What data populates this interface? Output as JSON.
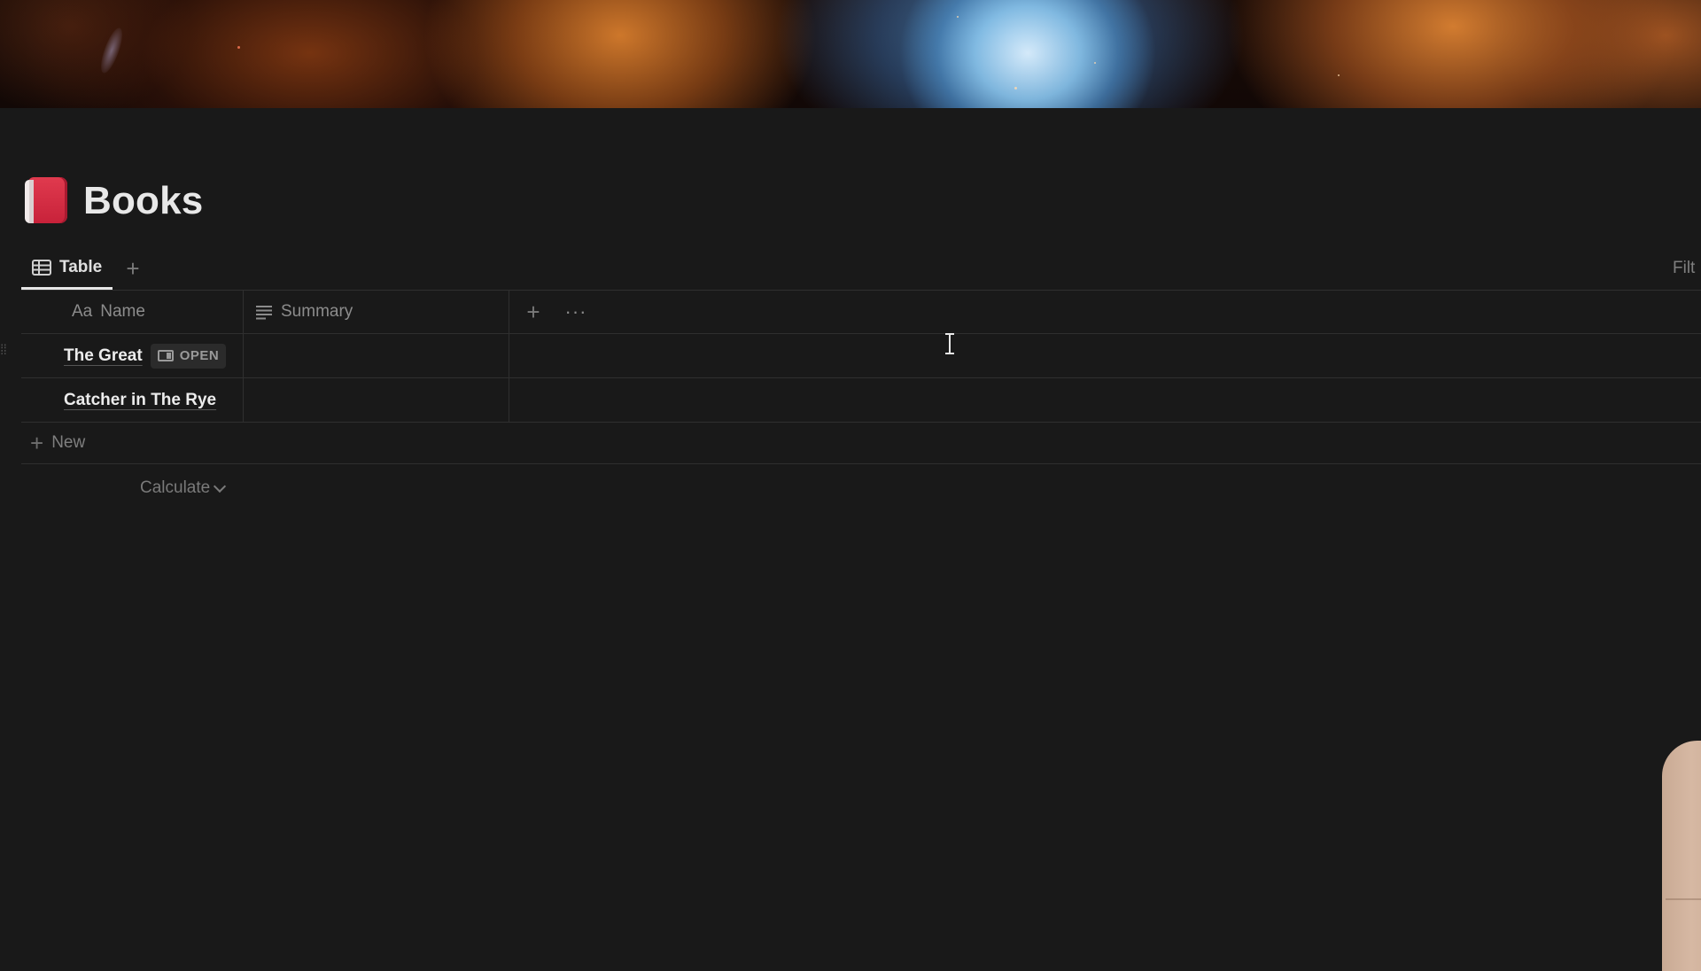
{
  "page": {
    "title": "Books",
    "icon": "red-book-icon"
  },
  "views": {
    "tabs": [
      {
        "label": "Table",
        "icon": "table-icon",
        "active": true
      }
    ],
    "add_view_icon": "plus-icon",
    "filter_label": "Filt"
  },
  "table": {
    "columns": [
      {
        "prefix": "Aa",
        "label": "Name",
        "icon": "text-type-icon"
      },
      {
        "label": "Summary",
        "icon": "lines-icon"
      }
    ],
    "add_column_icon": "plus-icon",
    "more_icon": "more-horizontal-icon",
    "more_label": "···",
    "rows": [
      {
        "name": "The Great",
        "open_label": "OPEN",
        "summary": ""
      },
      {
        "name": "Catcher in The Rye",
        "summary": ""
      }
    ],
    "new_row": {
      "icon": "plus-icon",
      "label": "New"
    },
    "calculate": {
      "label": "Calculate",
      "icon": "chevron-down-icon"
    }
  },
  "colors": {
    "background": "#191919",
    "text": "#d4d4d4",
    "muted": "#7f7f7f",
    "border": "#2f2f2f",
    "book_icon": "#d62f45"
  }
}
